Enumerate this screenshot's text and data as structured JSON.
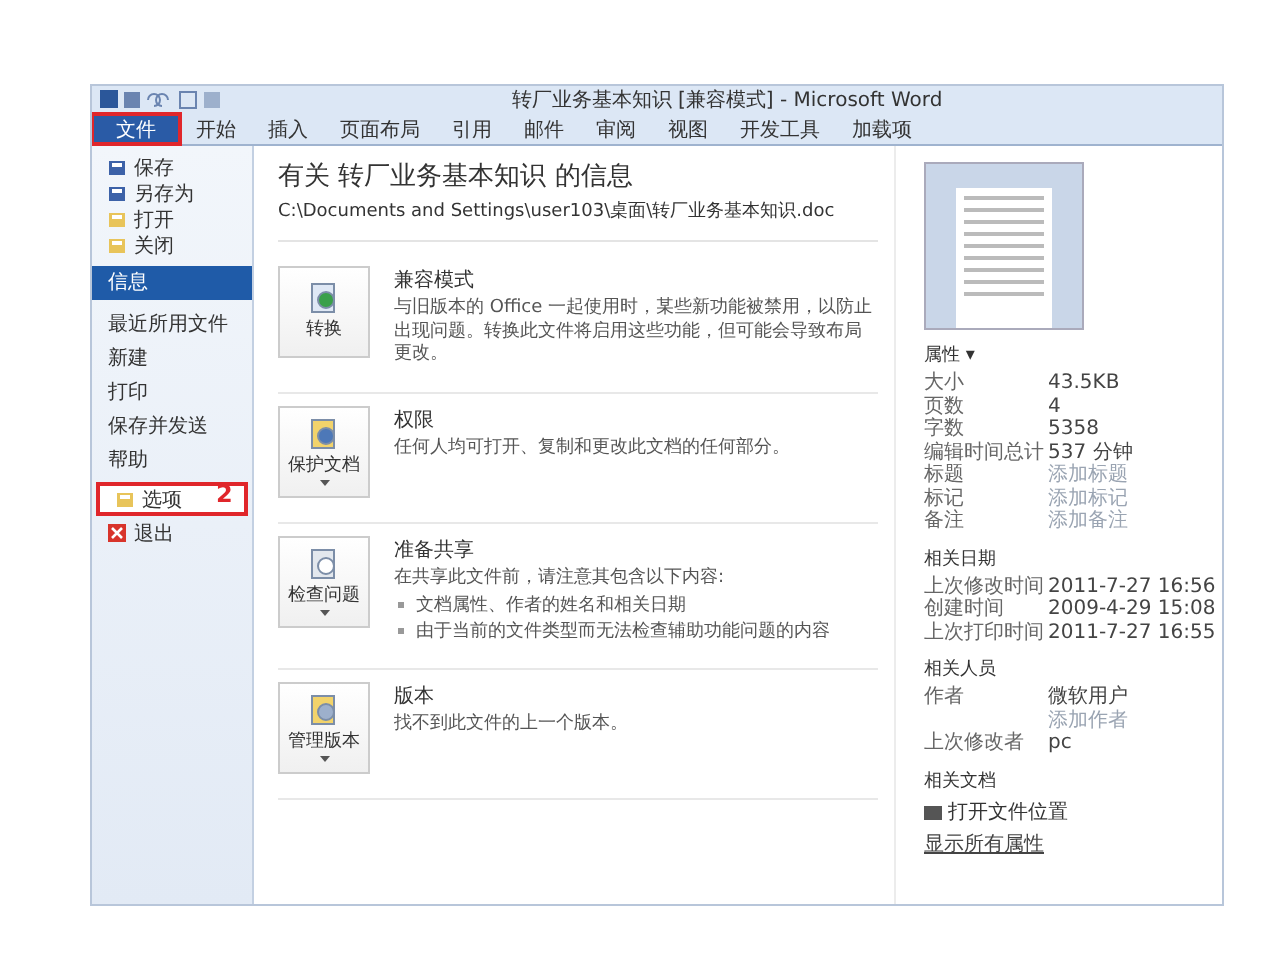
{
  "window": {
    "title": "转厂业务基本知识 [兼容模式] - Microsoft Word"
  },
  "ribbon_tabs": [
    {
      "label": "文件",
      "selected": true,
      "annotated": true
    },
    {
      "label": "开始",
      "selected": false,
      "annotated": false
    },
    {
      "label": "插入",
      "selected": false,
      "annotated": false
    },
    {
      "label": "页面布局",
      "selected": false,
      "annotated": false
    },
    {
      "label": "引用",
      "selected": false,
      "annotated": false
    },
    {
      "label": "邮件",
      "selected": false,
      "annotated": false
    },
    {
      "label": "审阅",
      "selected": false,
      "annotated": false
    },
    {
      "label": "视图",
      "selected": false,
      "annotated": false
    },
    {
      "label": "开发工具",
      "selected": false,
      "annotated": false
    },
    {
      "label": "加载项",
      "selected": false,
      "annotated": false
    }
  ],
  "sidebar": {
    "items": [
      {
        "kind": "command",
        "label": "保存",
        "hovered": false
      },
      {
        "kind": "command",
        "label": "另存为",
        "hovered": false
      },
      {
        "kind": "command",
        "label": "打开",
        "hovered": false
      },
      {
        "kind": "command",
        "label": "关闭",
        "hovered": false
      },
      {
        "kind": "page",
        "label": "信息",
        "selected": true
      },
      {
        "kind": "page",
        "label": "最近所用文件",
        "selected": false
      },
      {
        "kind": "page",
        "label": "新建",
        "selected": false
      },
      {
        "kind": "page",
        "label": "打印",
        "selected": false
      },
      {
        "kind": "page",
        "label": "保存并发送",
        "selected": false
      },
      {
        "kind": "page",
        "label": "帮助",
        "selected": false
      },
      {
        "kind": "command",
        "label": "选项",
        "hovered": true,
        "annotation": "2"
      },
      {
        "kind": "command",
        "label": "退出",
        "hovered": false
      }
    ]
  },
  "info": {
    "title": "有关 转厂业务基本知识 的信息",
    "path": "C:\\Documents and Settings\\user103\\桌面\\转厂业务基本知识.doc",
    "sections": [
      {
        "button": "转换",
        "dropdown": false,
        "heading": "兼容模式",
        "text": "与旧版本的 Office 一起使用时，某些新功能被禁用，以防止出现问题。转换此文件将启用这些功能，但可能会导致布局更改。"
      },
      {
        "button": "保护文档",
        "dropdown": true,
        "heading": "权限",
        "text": "任何人均可打开、复制和更改此文档的任何部分。"
      },
      {
        "button": "检查问题",
        "dropdown": true,
        "heading": "准备共享",
        "text": "在共享此文件前，请注意其包含以下内容:",
        "bullets": [
          "文档属性、作者的姓名和相关日期",
          "由于当前的文件类型而无法检查辅助功能问题的内容"
        ]
      },
      {
        "button": "管理版本",
        "dropdown": true,
        "heading": "版本",
        "text": "找不到此文件的上一个版本。"
      }
    ]
  },
  "properties": {
    "heading": "属性 ▾",
    "rows": [
      {
        "label": "大小",
        "value": "43.5KB",
        "muted": false
      },
      {
        "label": "页数",
        "value": "4",
        "muted": false
      },
      {
        "label": "字数",
        "value": "5358",
        "muted": false
      },
      {
        "label": "编辑时间总计",
        "value": "537 分钟",
        "muted": false
      },
      {
        "label": "标题",
        "value": "添加标题",
        "muted": true
      },
      {
        "label": "标记",
        "value": "添加标记",
        "muted": true
      },
      {
        "label": "备注",
        "value": "添加备注",
        "muted": true
      }
    ]
  },
  "related_dates": {
    "heading": "相关日期",
    "rows": [
      {
        "label": "上次修改时间",
        "value": "2011-7-27 16:56",
        "muted": false
      },
      {
        "label": "创建时间",
        "value": "2009-4-29 15:08",
        "muted": false
      },
      {
        "label": "上次打印时间",
        "value": "2011-7-27 16:55",
        "muted": false
      }
    ]
  },
  "related_people": {
    "heading": "相关人员",
    "rows": [
      {
        "label": "作者",
        "value": "微软用户",
        "muted": false
      },
      {
        "label": "",
        "value": "添加作者",
        "muted": true
      },
      {
        "label": "上次修改者",
        "value": "pc",
        "muted": false
      }
    ]
  },
  "related_documents": {
    "heading": "相关文档",
    "open_location": "打开文件位置",
    "show_all": "显示所有属性"
  }
}
